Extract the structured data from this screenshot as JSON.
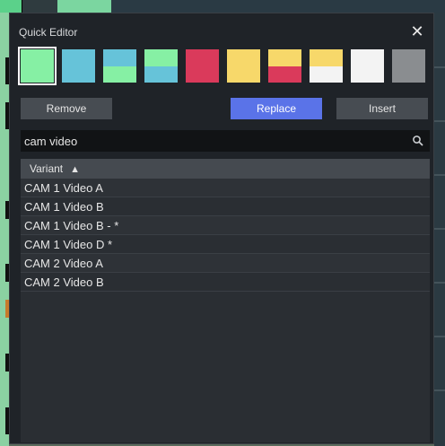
{
  "dialog": {
    "title": "Quick Editor",
    "close_glyph": "✕"
  },
  "swatches": [
    {
      "top": "#86f0a4",
      "bottom": "#86f0a4",
      "split": 0.0,
      "selected": true
    },
    {
      "top": "#66c3d9",
      "bottom": "#66c3d9",
      "split": 0.0,
      "selected": false
    },
    {
      "top": "#66c3d9",
      "bottom": "#86f0a4",
      "split": 0.5,
      "selected": false
    },
    {
      "top": "#86f0a4",
      "bottom": "#66c3d9",
      "split": 0.5,
      "selected": false
    },
    {
      "top": "#da3a5b",
      "bottom": "#da3a5b",
      "split": 0.0,
      "selected": false
    },
    {
      "top": "#f7d86a",
      "bottom": "#f7d86a",
      "split": 0.0,
      "selected": false
    },
    {
      "top": "#f7d86a",
      "bottom": "#da3a5b",
      "split": 0.5,
      "selected": false
    },
    {
      "top": "#f7d86a",
      "bottom": "#f3f3f3",
      "split": 0.5,
      "selected": false
    },
    {
      "top": "#f3f3f3",
      "bottom": "#f3f3f3",
      "split": 0.0,
      "selected": false
    },
    {
      "top": "#8a8d90",
      "bottom": "#8a8d90",
      "split": 0.0,
      "selected": false
    }
  ],
  "buttons": {
    "remove": "Remove",
    "replace": "Replace",
    "insert": "Insert"
  },
  "search": {
    "value": "cam video",
    "icon": "search-icon"
  },
  "list": {
    "column_header": "Variant",
    "sort_indicator": "▲",
    "items": [
      "CAM 1 Video A",
      "CAM 1 Video B",
      "CAM 1 Video B - *",
      "CAM 1 Video D *",
      "CAM 2 Video A",
      "CAM 2 Video B"
    ]
  }
}
